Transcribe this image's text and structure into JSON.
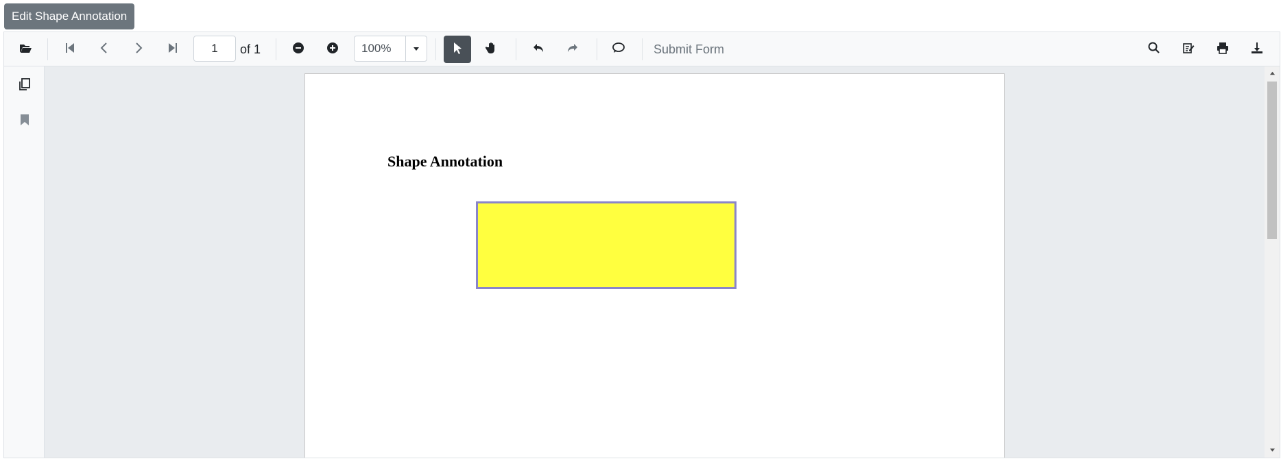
{
  "top_button": {
    "label": "Edit Shape Annotation"
  },
  "toolbar": {
    "current_page": "1",
    "of_label": "of 1",
    "zoom": "100%",
    "submit_form_label": "Submit Form"
  },
  "document": {
    "heading": "Shape Annotation",
    "shape_fill": "#ffff3f",
    "shape_border": "#8a85c9"
  },
  "icons": [
    "open-folder-icon",
    "first-page-icon",
    "previous-page-icon",
    "next-page-icon",
    "last-page-icon",
    "zoom-out-icon",
    "zoom-in-icon",
    "zoom-dropdown-icon",
    "select-pointer-icon",
    "pan-hand-icon",
    "undo-icon",
    "redo-icon",
    "comment-icon",
    "search-icon",
    "annotation-edit-icon",
    "print-icon",
    "download-icon",
    "page-thumbnails-icon",
    "bookmark-icon"
  ]
}
